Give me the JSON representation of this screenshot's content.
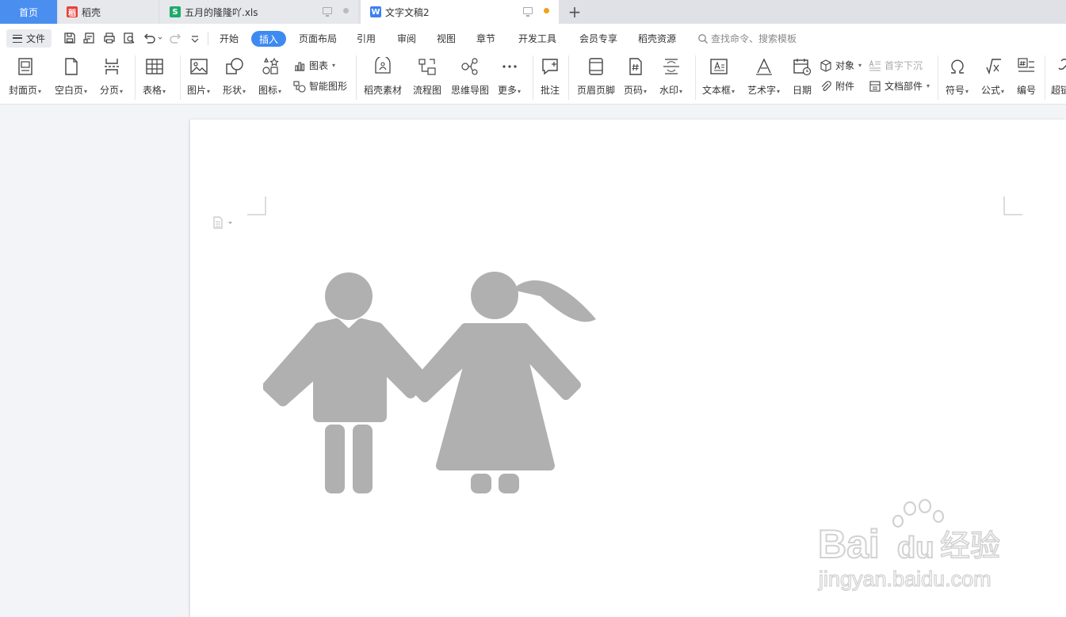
{
  "tabs": [
    {
      "label": "首页"
    },
    {
      "label": "稻壳",
      "icon": "daoke-app-icon"
    },
    {
      "label": "五月的隆隆吖.xls",
      "icon": "spreadsheet-app-icon"
    },
    {
      "label": "文字文稿2",
      "icon": "writer-app-icon",
      "active": true
    }
  ],
  "app_icons": {
    "daoke": "稻",
    "sheet": "S",
    "writer": "W"
  },
  "menu": {
    "file_label": "文件",
    "items": [
      "开始",
      "插入",
      "页面布局",
      "引用",
      "审阅",
      "视图",
      "章节",
      "开发工具",
      "会员专享",
      "稻壳资源"
    ],
    "active": "插入",
    "search_placeholder": "查找命令、搜索模板"
  },
  "ribbon": {
    "cover": "封面页",
    "blank": "空白页",
    "break": "分页",
    "table": "表格",
    "picture": "图片",
    "shape": "形状",
    "icons": "图标",
    "chart": "图表",
    "smartart": "智能图形",
    "daoke_material": "稻壳素材",
    "flowchart": "流程图",
    "mindmap": "思维导图",
    "more": "更多",
    "comment": "批注",
    "header_footer": "页眉页脚",
    "page_number": "页码",
    "watermark": "水印",
    "textbox": "文本框",
    "wordart": "艺术字",
    "date": "日期",
    "object": "对象",
    "attachment": "附件",
    "dropcap": "首字下沉",
    "doc_parts": "文档部件",
    "symbol": "符号",
    "formula": "公式",
    "numbering": "编号",
    "hyperlink_partial": "超链"
  },
  "watermark": {
    "brand": "Bai",
    "brand2": "du",
    "cn": "经验",
    "url": "jingyan.baidu.com"
  },
  "colors": {
    "accent": "#3e8af0",
    "home_tab": "#4a8ef0",
    "figure_gray": "#b0b0b0",
    "unsaved_dot": "#f0a020",
    "sheet_green": "#1faa6a",
    "daoke_red": "#e8413a"
  }
}
